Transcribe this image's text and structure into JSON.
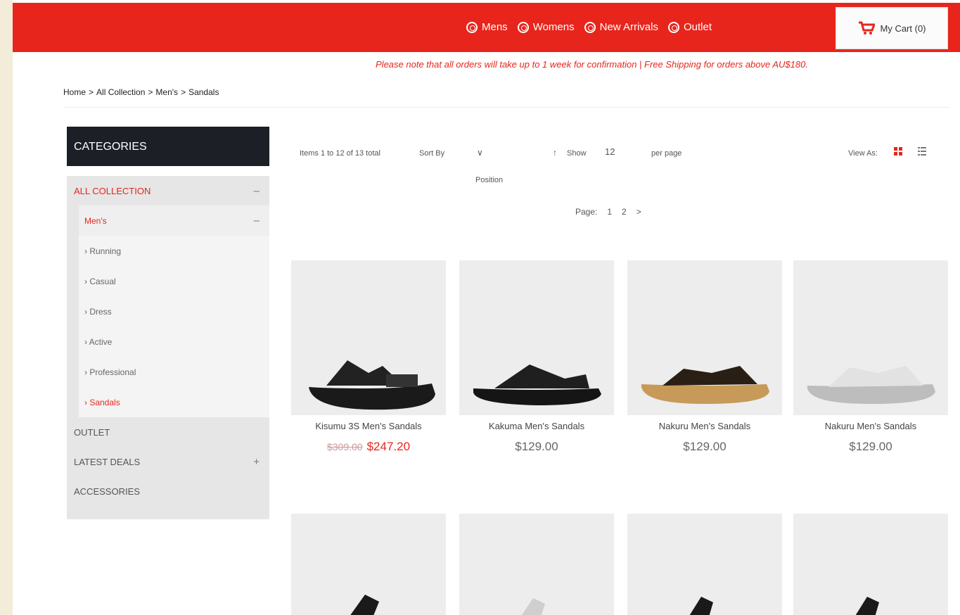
{
  "header": {
    "nav": [
      "Mens",
      "Womens",
      "New Arrivals",
      "Outlet"
    ],
    "cart_label": "My Cart (0)",
    "notice": "Please note that all orders will take up to 1 week for confirmation | Free Shipping for orders above AU$180."
  },
  "breadcrumb": [
    "Home",
    ">",
    "All Collection",
    ">",
    "Men's",
    ">",
    "Sandals"
  ],
  "sidebar": {
    "title": "CATEGORIES",
    "items": [
      {
        "label": "ALL COLLECTION",
        "toggle": "–"
      },
      {
        "label": "Men's",
        "toggle": "–"
      },
      {
        "label": "› Running"
      },
      {
        "label": "› Casual"
      },
      {
        "label": "› Dress"
      },
      {
        "label": "› Active"
      },
      {
        "label": "› Professional"
      },
      {
        "label": "› Sandals"
      },
      {
        "label": "OUTLET"
      },
      {
        "label": "LATEST DEALS",
        "toggle": "+"
      },
      {
        "label": "ACCESSORIES"
      }
    ]
  },
  "toolbar": {
    "count": "Items 1 to 12 of 13 total",
    "sort_label": "Sort By",
    "sort_chevron": "∨",
    "sort_value": "Position",
    "arrow": "↑",
    "show_label": "Show",
    "limit": "12",
    "per_page": "per page",
    "view_as": "View As:"
  },
  "pager": {
    "label": "Page:",
    "pages": [
      "1",
      "2"
    ],
    "next": ">"
  },
  "products": [
    {
      "name": "Kisumu 3S Men's Sandals",
      "old_price": "$309.00",
      "price": "$247.20",
      "color": "#1a1a1a"
    },
    {
      "name": "Kakuma Men's Sandals",
      "price": "$129.00",
      "color": "#151515"
    },
    {
      "name": "Nakuru Men's Sandals",
      "price": "$129.00",
      "color": "#2a1f14"
    },
    {
      "name": "Nakuru Men's Sandals",
      "price": "$129.00",
      "color": "#dcdcdc"
    }
  ],
  "colors": {
    "accent": "#e8251c",
    "dark": "#1c1f26"
  }
}
